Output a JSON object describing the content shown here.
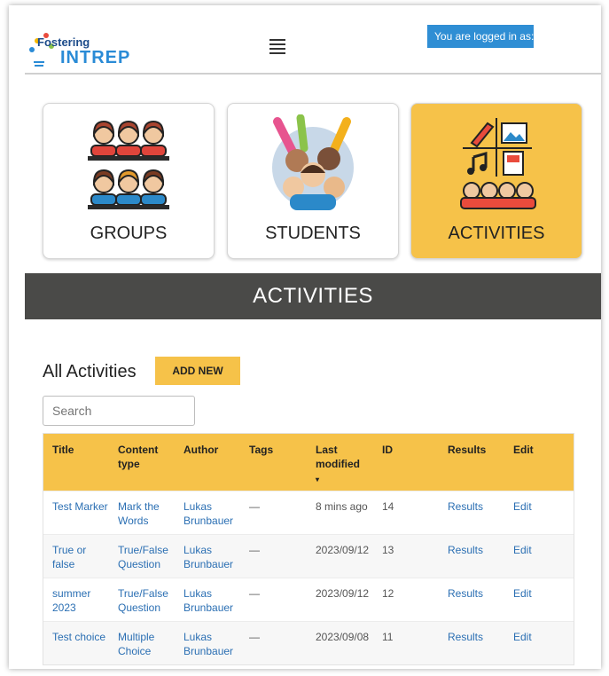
{
  "header": {
    "logo_top": "Fostering",
    "logo_bottom": "INTREP",
    "menu_icon": "hamburger-icon",
    "login_text": "You are logged in as:"
  },
  "tiles": [
    {
      "label": "GROUPS",
      "icon": "groups-icon",
      "active": false
    },
    {
      "label": "STUDENTS",
      "icon": "students-icon",
      "active": false
    },
    {
      "label": "ACTIVITIES",
      "icon": "activities-icon",
      "active": true
    }
  ],
  "banner": {
    "title": "ACTIVITIES"
  },
  "list": {
    "title": "All Activities",
    "add_new": "ADD NEW",
    "search_placeholder": "Search"
  },
  "table": {
    "headers": {
      "title": "Title",
      "content_type": "Content type",
      "author": "Author",
      "tags": "Tags",
      "last_modified": "Last modified",
      "sort_indicator": "▾",
      "id": "ID",
      "results": "Results",
      "edit": "Edit"
    },
    "rows": [
      {
        "title": "Test Marker",
        "content_type": "Mark the Words",
        "author": "Lukas Brunbauer",
        "tags": "—",
        "last_modified": "8 mins ago",
        "id": "14",
        "results": "Results",
        "edit": "Edit"
      },
      {
        "title": "True or false",
        "content_type": "True/False Question",
        "author": "Lukas Brunbauer",
        "tags": "—",
        "last_modified": "2023/09/12",
        "id": "13",
        "results": "Results",
        "edit": "Edit"
      },
      {
        "title": "summer 2023",
        "content_type": "True/False Question",
        "author": "Lukas Brunbauer",
        "tags": "—",
        "last_modified": "2023/09/12",
        "id": "12",
        "results": "Results",
        "edit": "Edit"
      },
      {
        "title": "Test choice",
        "content_type": "Multiple Choice",
        "author": "Lukas Brunbauer",
        "tags": "—",
        "last_modified": "2023/09/08",
        "id": "11",
        "results": "Results",
        "edit": "Edit"
      }
    ]
  },
  "colors": {
    "accent": "#f6c249",
    "banner": "#4a4a48",
    "link": "#2b6fb3",
    "badge": "#2f8ed4"
  }
}
